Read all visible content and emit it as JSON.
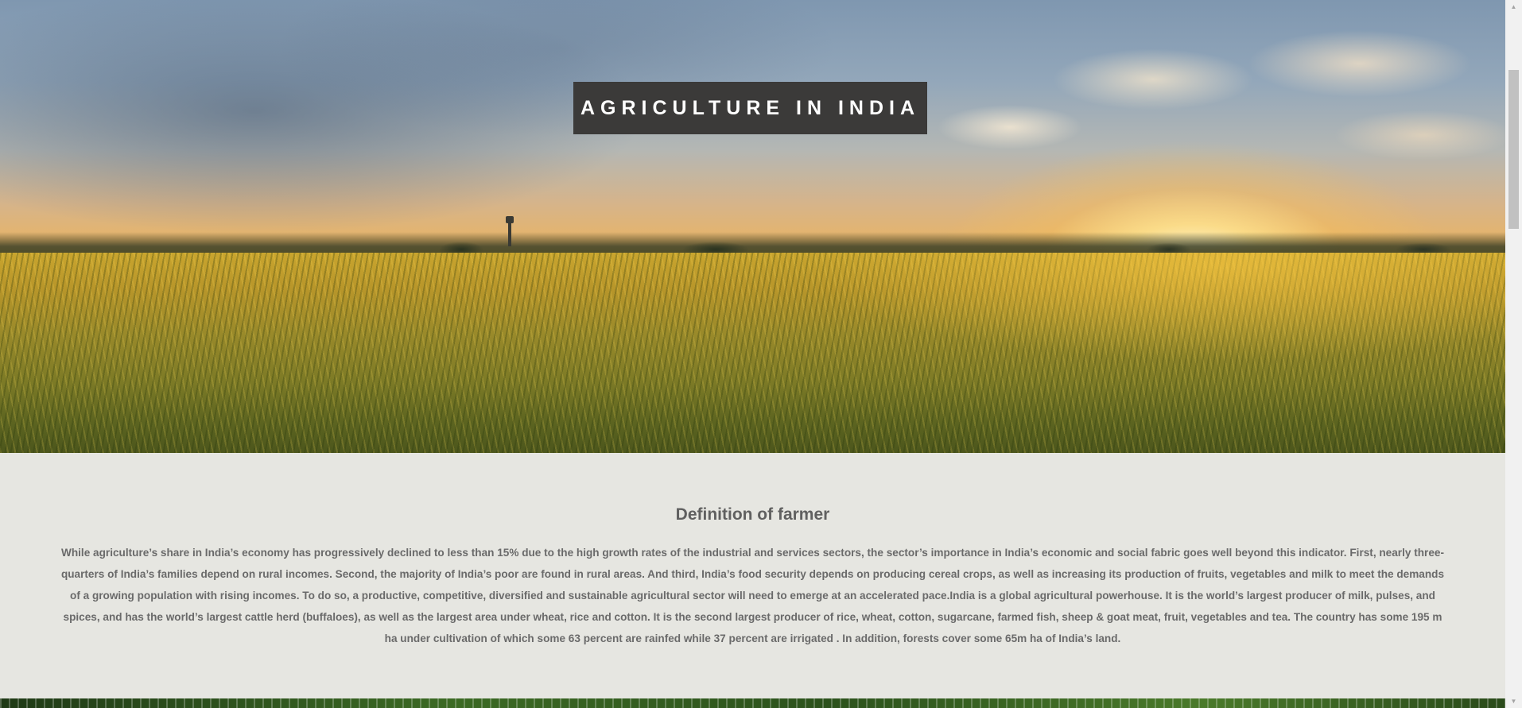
{
  "hero": {
    "title": "AGRICULTURE IN INDIA"
  },
  "section": {
    "heading": "Definition of farmer",
    "body": "While agriculture’s share in India’s economy has progressively declined to less than 15% due to the high growth rates of the industrial and services sectors, the sector’s importance in India’s economic and social fabric goes well beyond this indicator. First, nearly three-quarters of India’s families depend on rural incomes. Second, the majority of India’s poor are found in rural areas. And third, India’s food security depends on producing cereal crops, as well as increasing its production of fruits, vegetables and milk to meet the demands of a growing population with rising incomes. To do so, a productive, competitive, diversified and sustainable agricultural sector will need to emerge at an accelerated pace.India is a global agricultural powerhouse. It is the world’s largest producer of milk, pulses, and spices, and has the world’s largest cattle herd (buffaloes), as well as the largest area under wheat, rice and cotton. It is the second largest producer of rice, wheat, cotton, sugarcane, farmed fish, sheep & goat meat, fruit, vegetables and tea. The country has some 195 m ha under cultivation of which some 63 percent are rainfed while 37 percent are irrigated . In addition, forests cover some 65m ha of India’s land."
  },
  "colors": {
    "title_box_bg": "#3b3a39",
    "content_bg": "#e6e6e1",
    "heading_text": "#606060",
    "body_text": "#6a6a6a"
  },
  "scrollbar": {
    "up_icon": "triangle-up",
    "down_icon": "triangle-down"
  }
}
